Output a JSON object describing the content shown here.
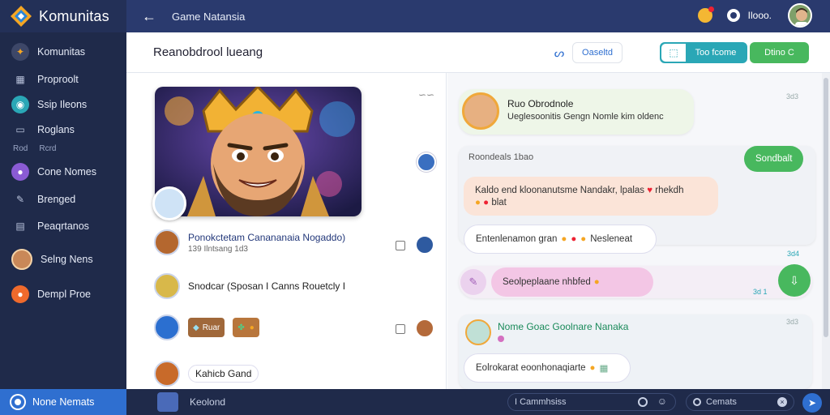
{
  "sidebar": {
    "brand": "Komunitas",
    "items": [
      {
        "label": "Komunitas",
        "icon": "compass-icon"
      },
      {
        "label": "Proproolt",
        "icon": "grid-icon"
      },
      {
        "label": "Ssip Ileons",
        "icon": "globe-icon"
      },
      {
        "label": "Roglans",
        "icon": "folder-icon"
      },
      {
        "label": "Cone Nomes",
        "icon": "user-icon"
      },
      {
        "label": "Brenged",
        "icon": "pen-icon"
      },
      {
        "label": "Peaqrtanos",
        "icon": "doc-icon"
      },
      {
        "label": "Selng Nens",
        "icon": "user-icon"
      },
      {
        "label": "Dempl Proe",
        "icon": "flame-icon"
      }
    ],
    "section_label": "Rod",
    "section_label_2": "Rcrd",
    "bottom_label": "None Nemats"
  },
  "topbar": {
    "back": "←",
    "title": "Game Natansia",
    "user": "Ilooo."
  },
  "subbar": {
    "title": "Reanobdrool lueang",
    "pill1": "Oaseltd",
    "pill2": "Too fcome",
    "pill3": "Dtino C"
  },
  "feed": {
    "hero_action": "∽∽",
    "post1_title": "Ponokctetam Canananaia Nogaddo)",
    "post1_sub": "139 Ilntsang 1d3",
    "post2_text": "Snodcar (Sposan I Canns Rouetcly I",
    "chip1": "Ruar",
    "post4_text": "Kahicb Gand"
  },
  "chat": {
    "card1_name": "Ruo Obrodnole",
    "card1_text": "Ueglesoonitis Gengn Nomle kim oldenc",
    "card1_time": "3d3",
    "card2_header": "Roondeals 1bao",
    "card2_btn": "Sondbalt",
    "msg1_line1": "Kaldo end kloonanutsme Nandakr, lpalas",
    "msg1_line1b": "rhekdh",
    "msg1_line2": "blat",
    "msg2": "Entenlenamon gran",
    "msg2b": "Nesleneat",
    "msg2_time": "3d4",
    "msg3": "Seolpeplaane nhbfed",
    "msg3_time": "3d 1",
    "card3_name": "Nome Goac Goolnare Nanaka",
    "card3_time": "3d3",
    "msg4": "Eolrokarat eoonhonaqiarte"
  },
  "bottom": {
    "left_label": "Keolond",
    "input1": "I Cammhsiss",
    "input2": "Cemats"
  },
  "colors": {
    "sidebar_bg": "#1f2a4a",
    "topbar_bg": "#2a3a6e",
    "accent_blue": "#2f6fd0",
    "accent_teal": "#2aa7b6",
    "accent_green": "#48b85e"
  }
}
